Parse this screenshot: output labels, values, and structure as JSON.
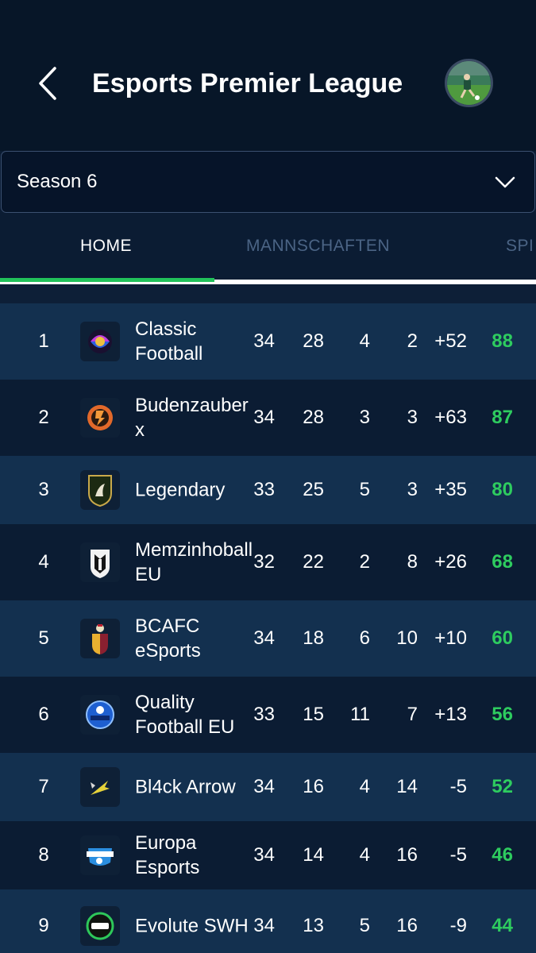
{
  "header": {
    "title": "Esports Premier League",
    "back_icon": "chevron-left-icon",
    "avatar_icon": "user-avatar-icon"
  },
  "season_select": {
    "value": "Season 6",
    "icon": "chevron-down-icon"
  },
  "tabs": [
    {
      "label": "HOME",
      "active": true
    },
    {
      "label": "MANNSCHAFTEN",
      "active": false
    },
    {
      "label": "SPI",
      "active": false
    }
  ],
  "colors": {
    "background": "#0b1c33",
    "header_bg": "#071628",
    "row_alt": "#13304f",
    "accent_green": "#21c25a",
    "points_green": "#2ecc5f",
    "inactive_tab": "#4b6485"
  },
  "table": {
    "rows": [
      {
        "pos": "1",
        "team": "Classic Football",
        "sp": "34",
        "s": "28",
        "u": "4",
        "n": "2",
        "gd": "+52",
        "pts": "88",
        "logo": "classic-football-logo-icon"
      },
      {
        "pos": "2",
        "team": "Budenzauber x",
        "sp": "34",
        "s": "28",
        "u": "3",
        "n": "3",
        "gd": "+63",
        "pts": "87",
        "logo": "budenzauber-logo-icon"
      },
      {
        "pos": "3",
        "team": "Legendary",
        "sp": "33",
        "s": "25",
        "u": "5",
        "n": "3",
        "gd": "+35",
        "pts": "80",
        "logo": "legendary-logo-icon"
      },
      {
        "pos": "4",
        "team": "Memzinhoball EU",
        "sp": "32",
        "s": "22",
        "u": "2",
        "n": "8",
        "gd": "+26",
        "pts": "68",
        "logo": "memzinhoball-logo-icon"
      },
      {
        "pos": "5",
        "team": "BCAFC eSports",
        "sp": "34",
        "s": "18",
        "u": "6",
        "n": "10",
        "gd": "+10",
        "pts": "60",
        "logo": "bcafc-logo-icon"
      },
      {
        "pos": "6",
        "team": "Quality Football EU",
        "sp": "33",
        "s": "15",
        "u": "11",
        "n": "7",
        "gd": "+13",
        "pts": "56",
        "logo": "quality-football-logo-icon"
      },
      {
        "pos": "7",
        "team": "Bl4ck Arrow",
        "sp": "34",
        "s": "16",
        "u": "4",
        "n": "14",
        "gd": "-5",
        "pts": "52",
        "logo": "black-arrow-logo-icon"
      },
      {
        "pos": "8",
        "team": "Europa Esports",
        "sp": "34",
        "s": "14",
        "u": "4",
        "n": "16",
        "gd": "-5",
        "pts": "46",
        "logo": "europa-esports-logo-icon"
      },
      {
        "pos": "9",
        "team": "Evolute SWH",
        "sp": "34",
        "s": "13",
        "u": "5",
        "n": "16",
        "gd": "-9",
        "pts": "44",
        "logo": "evolute-swh-logo-icon"
      }
    ]
  }
}
